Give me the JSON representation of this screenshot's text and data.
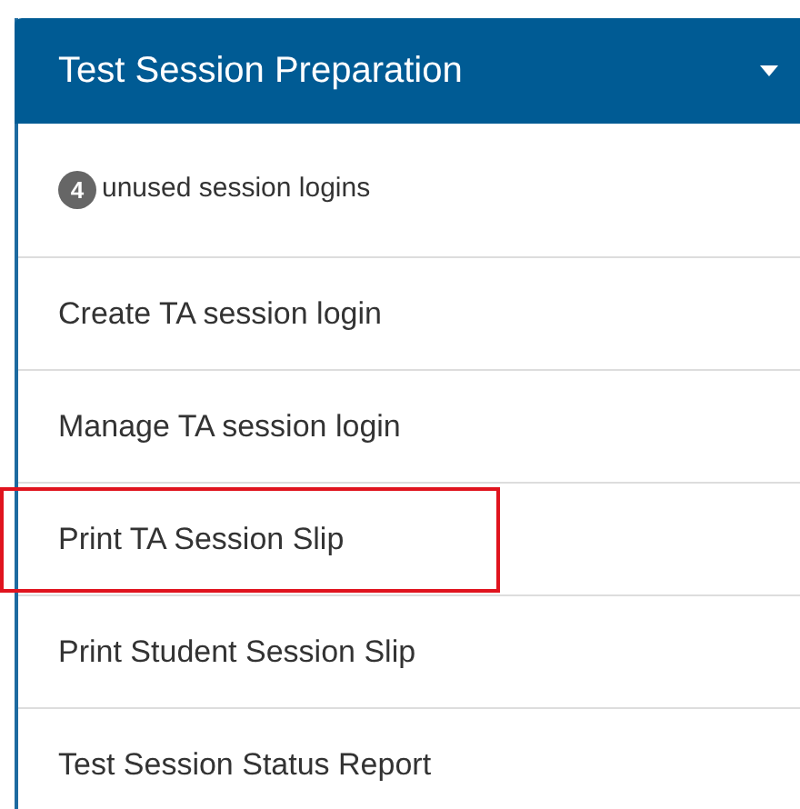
{
  "panel": {
    "title": "Test Session Preparation",
    "expanded": true
  },
  "unused_logins": {
    "count": "4",
    "label": "unused session logins"
  },
  "items": [
    {
      "label": "Create TA session login",
      "highlighted": false
    },
    {
      "label": "Manage TA session login",
      "highlighted": false
    },
    {
      "label": "Print TA Session Slip",
      "highlighted": true
    },
    {
      "label": "Print Student Session Slip",
      "highlighted": false
    },
    {
      "label": "Test Session Status Report",
      "highlighted": false
    }
  ]
}
